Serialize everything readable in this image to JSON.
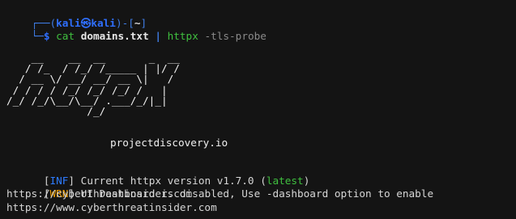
{
  "prompt": {
    "frame_top_left": "┌──(",
    "user": "kali",
    "at": "㉿",
    "host": "kali",
    "frame_close": ")-[",
    "cwd": "~",
    "frame_end": "]",
    "frame_bottom_left": "└─",
    "symbol": "$ ",
    "command": "cat ",
    "arg": "domains.txt",
    "space_pipe": " | ",
    "command2": "httpx ",
    "flag": "-tls-probe"
  },
  "banner": {
    "ascii_art": "    __    __  __       _  __\n   / /_  / /_/ /_____ | |/ /\n  / __ \\/ __/ __/ __ \\|   /\n / / / / /_/ /_/ /_/ /   |\n/_/ /_/\\__/\\__/ .___/_/|_|\n             /_/",
    "credit": "projectdiscovery.io"
  },
  "logs": [
    {
      "tag_open": "[",
      "tag": "INF",
      "tag_close": "]",
      "text_before": " Current httpx version v1.7.0 (",
      "highlight": "latest",
      "text_after": ")"
    },
    {
      "tag_open": "[",
      "tag": "WRN",
      "tag_close": "]",
      "text": " UI Dashboard is disabled, Use -dashboard option to enable"
    }
  ],
  "results": [
    "https://cyberthreatinsider.com",
    "https://www.cyberthreatinsider.com"
  ],
  "colors": {
    "background": "#141414",
    "prompt_frame": "#3f7de6",
    "user": "#2f6fff",
    "command": "#3fbf3f",
    "info_tag": "#2d7cff",
    "warn_tag": "#f0a000",
    "latest": "#3fbf3f"
  }
}
